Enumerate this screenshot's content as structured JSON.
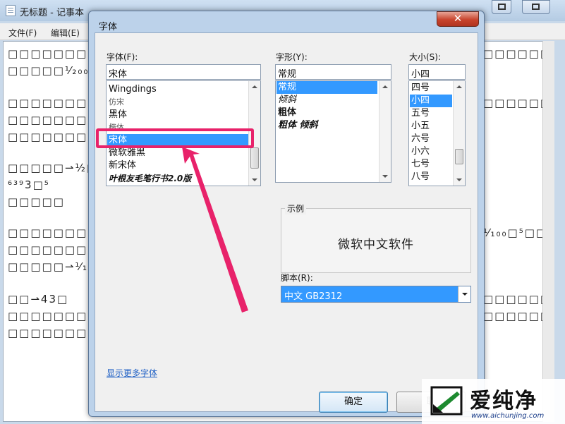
{
  "notepad": {
    "title": "无标题 - 记事本",
    "menu": [
      "文件(F)",
      "编辑(E)"
    ],
    "lines": [
      "□□□□□□□□",
      "□□□□□⅟₂₀₀□",
      "□□□□□□□□",
      "□□□□□□□□",
      "□□□□□□□□",
      "□□□□□⇀½□",
      "⁶³⁹3□⁵",
      "□□□□□",
      "□□□□□□□□",
      "□□□□□□□□",
      "□□□□□⇀⅟₁₈",
      "□□⇀43□",
      "□□□□□□□□",
      "□□□□□□□□"
    ],
    "right_lines": [
      "□□□□□□",
      "□□□□□□",
      "⅟₁₀₀□⁵□□",
      "□□□□□□",
      "□□□□□□"
    ]
  },
  "dialog": {
    "title": "字体",
    "close_label": "✕",
    "font": {
      "label": "字体(F):",
      "value": "宋体",
      "items": [
        "Wingdings",
        "仿宋",
        "黑体",
        "楷体",
        "宋体",
        "微软雅黑",
        "新宋体",
        "叶根友毛笔行书2.0版"
      ],
      "selected_index": 4
    },
    "style": {
      "label": "字形(Y):",
      "value": "常规",
      "items": [
        "常规",
        "倾斜",
        "粗体",
        "粗体 倾斜"
      ],
      "selected_index": 0
    },
    "size": {
      "label": "大小(S):",
      "value": "小四",
      "items": [
        "四号",
        "小四",
        "五号",
        "小五",
        "六号",
        "小六",
        "七号",
        "八号"
      ],
      "selected_index": 1
    },
    "sample": {
      "label": "示例",
      "text": "微软中文软件"
    },
    "script": {
      "label": "脚本(R):",
      "value": "中文 GB2312"
    },
    "more_fonts_link": "显示更多字体",
    "ok_label": "确定",
    "cancel_label": "取"
  },
  "watermark": {
    "main": "爱纯净",
    "sub": "www.aichunjing.com"
  },
  "colors": {
    "highlight": "#e8226a",
    "selection": "#3399ff"
  }
}
